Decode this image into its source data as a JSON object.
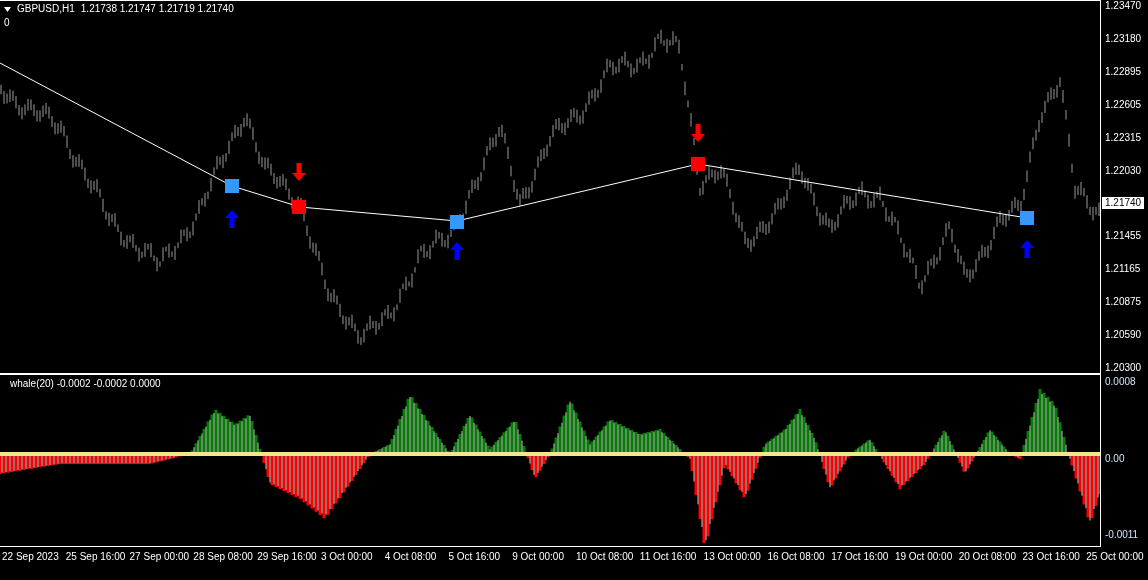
{
  "chart": {
    "symbol": "GBPUSD,H1",
    "quote": "1.21738 1.21747 1.21719 1.21740",
    "sub_label": "0"
  },
  "price_axis": {
    "labels": [
      "1.23470",
      "1.23180",
      "1.22895",
      "1.22605",
      "1.22315",
      "1.22030",
      "1.21455",
      "1.21165",
      "1.20875",
      "1.20590",
      "1.20300"
    ],
    "current_price": "1.21740"
  },
  "indicator": {
    "label": "whale(20) -0.0002 -0.0002 0.0000",
    "axis_labels": [
      "0.0008",
      "0.00",
      "-0.0011"
    ]
  },
  "time_axis": {
    "labels": [
      "22 Sep 2023",
      "25 Sep 16:00",
      "27 Sep 00:00",
      "28 Sep 08:00",
      "29 Sep 16:00",
      "3 Oct 00:00",
      "4 Oct 08:00",
      "5 Oct 16:00",
      "9 Oct 00:00",
      "10 Oct 08:00",
      "11 Oct 16:00",
      "13 Oct 00:00",
      "16 Oct 08:00",
      "17 Oct 16:00",
      "19 Oct 00:00",
      "20 Oct 08:00",
      "23 Oct 16:00",
      "25 Oct 00:00"
    ]
  }
}
